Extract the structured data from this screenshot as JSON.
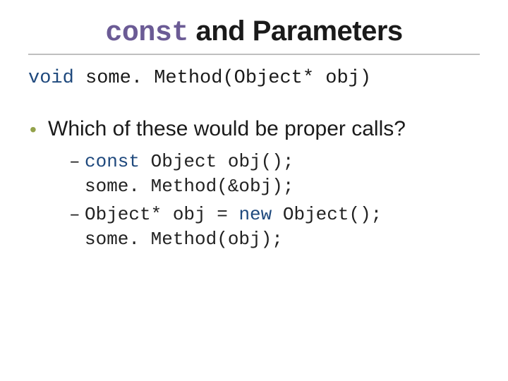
{
  "title": {
    "keyword": "const",
    "rest": " and Parameters"
  },
  "signature": {
    "ret": "void",
    "rest": " some. Method(Object* obj)"
  },
  "question": "Which of these would be proper calls?",
  "options": [
    {
      "kw1": "const",
      "after_kw1": " Object obj();",
      "line2": "some. Method(&obj);"
    },
    {
      "line1_pre": "Object* obj = ",
      "kw2": "new",
      "line1_post": " Object();",
      "line2": "some. Method(obj);"
    }
  ]
}
